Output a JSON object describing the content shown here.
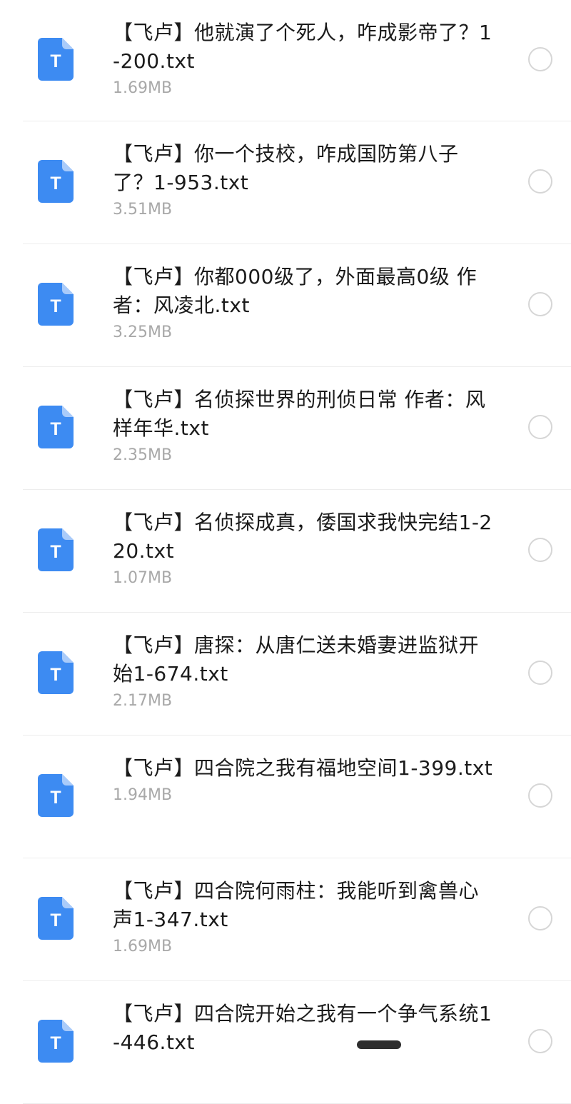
{
  "files": [
    {
      "name": "【飞卢】他就演了个死人，咋成影帝了？1-200.txt",
      "size": "1.69MB",
      "icon": "txt-file-icon",
      "icon_letter": "T"
    },
    {
      "name": "【飞卢】你一个技校，咋成国防第八子了？1-953.txt",
      "size": "3.51MB",
      "icon": "txt-file-icon",
      "icon_letter": "T"
    },
    {
      "name": "【飞卢】你都000级了，外面最高0级 作者：风凌北.txt",
      "size": "3.25MB",
      "icon": "txt-file-icon",
      "icon_letter": "T"
    },
    {
      "name": "【飞卢】名侦探世界的刑侦日常 作者：风样年华.txt",
      "size": "2.35MB",
      "icon": "txt-file-icon",
      "icon_letter": "T"
    },
    {
      "name": "【飞卢】名侦探成真，倭国求我快完结1-220.txt",
      "size": "1.07MB",
      "icon": "txt-file-icon",
      "icon_letter": "T"
    },
    {
      "name": "【飞卢】唐探：从唐仁送未婚妻进监狱开始1-674.txt",
      "size": "2.17MB",
      "icon": "txt-file-icon",
      "icon_letter": "T"
    },
    {
      "name": "【飞卢】四合院之我有福地空间1-399.txt",
      "size": "1.94MB",
      "icon": "txt-file-icon",
      "icon_letter": "T"
    },
    {
      "name": "【飞卢】四合院何雨柱：我能听到禽兽心声1-347.txt",
      "size": "1.69MB",
      "icon": "txt-file-icon",
      "icon_letter": "T"
    },
    {
      "name": "【飞卢】四合院开始之我有一个争气系统1-446.txt",
      "size": "",
      "icon": "txt-file-icon",
      "icon_letter": "T"
    }
  ],
  "colors": {
    "icon_blue": "#3d8bf2",
    "icon_fold": "#a9cbfa",
    "text_primary": "#1b1b1b",
    "text_secondary": "#a8a8a8",
    "radio_border": "#d6d6d6",
    "divider": "#ededed"
  }
}
